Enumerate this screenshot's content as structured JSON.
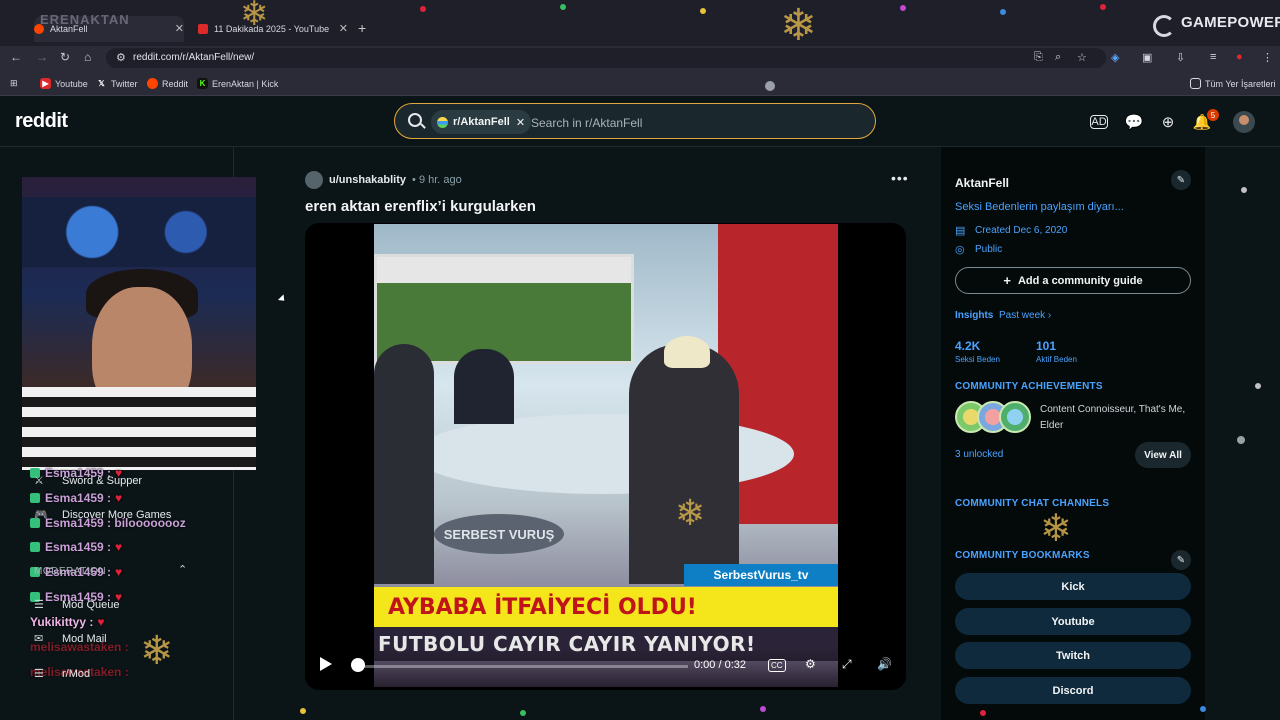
{
  "browser": {
    "tabs": [
      {
        "title": "AktanFell"
      },
      {
        "title": "11 Dakikada 2025 - YouTube"
      }
    ],
    "url": "reddit.com/r/AktanFell/new/",
    "bookmarks": [
      {
        "label": "Youtube",
        "color": "#e02a2a"
      },
      {
        "label": "Twitter",
        "color": "#ffffff"
      },
      {
        "label": "Reddit",
        "color": "#ff4500"
      },
      {
        "label": "ErenAktan | Kick",
        "color": "#53fc18"
      }
    ],
    "bookmarks_folder": "Tüm Yer İşaretleri"
  },
  "header": {
    "logo": "reddit",
    "search_chip": "r/AktanFell",
    "search_placeholder": "Search in r/AktanFell",
    "notification_count": "5",
    "accent": "#e0a83a"
  },
  "leftnav": {
    "items": [
      {
        "label": "Sword & Supper",
        "icon": "game-icon"
      },
      {
        "label": "Discover More Games",
        "icon": "controller-icon"
      },
      {
        "label": "Mod Queue",
        "icon": "queue-icon"
      },
      {
        "label": "Mod Mail",
        "icon": "mail-icon"
      },
      {
        "label": "r/Mod",
        "icon": "list-icon"
      }
    ],
    "section": "MODERATION"
  },
  "chat": [
    {
      "text": "Esma1459 :",
      "color": "#c9a0d8"
    },
    {
      "text": "Esma1459 :",
      "color": "#c9a0d8"
    },
    {
      "text": "Esma1459 : biloooooooz",
      "color": "#c9a0d8"
    },
    {
      "text": "Esma1459 :",
      "color": "#c9a0d8"
    },
    {
      "text": "Esma1459 :",
      "color": "#c9a0d8"
    },
    {
      "text": "Esma1459 :",
      "color": "#c9a0d8"
    },
    {
      "text": "Yukikittyy :",
      "color": "#f1b7e8"
    },
    {
      "text": "melisawastaken :",
      "color": "#e0233a"
    },
    {
      "text": "melisawastaken :",
      "color": "#e0233a"
    }
  ],
  "post": {
    "user": "u/unshakablity",
    "time": "9 hr. ago",
    "title": "eren aktan erenflix’i kurgularken",
    "video": {
      "logo": "SERBEST VURUŞ",
      "ticker_tag": "SerbestVurus_tv",
      "ticker_line1": "AYBABA İTFAİYECİ OLDU!",
      "ticker_line2": "FUTBOLU CAYIR CAYIR YANIYOR!",
      "time": "0:00 / 0:32",
      "progress": 0
    }
  },
  "community": {
    "name": "AktanFell",
    "description": "Seksi Bedenlerin paylaşım diyarı...",
    "created": "Created Dec 6, 2020",
    "visibility": "Public",
    "guide_button": "Add a community guide",
    "insights_label": "Insights",
    "insights_range": "Past week",
    "stats": [
      {
        "value": "4.2K",
        "label": "Seksi Beden"
      },
      {
        "value": "101",
        "label": "Aktif Beden"
      }
    ],
    "achievements_title": "COMMUNITY ACHIEVEMENTS",
    "achievements_text": "Content Connoisseur, That's Me, Elder",
    "unlocked": "3 unlocked",
    "view_all": "View All",
    "chat_channels_title": "COMMUNITY CHAT CHANNELS",
    "bookmarks_title": "COMMUNITY BOOKMARKS",
    "bookmarks": [
      {
        "label": "Kick"
      },
      {
        "label": "Youtube"
      },
      {
        "label": "Twitch"
      },
      {
        "label": "Discord"
      }
    ]
  },
  "overlay": {
    "brand": "GAMEPOWER",
    "watermark": "ERENAKTAN"
  }
}
